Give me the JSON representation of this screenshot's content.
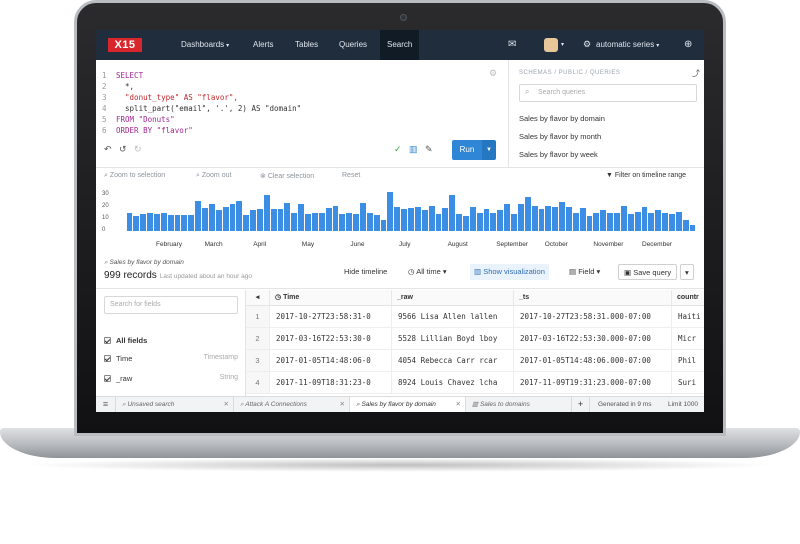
{
  "nav": {
    "logo": "X15",
    "items": [
      {
        "label": "Dashboards",
        "caret": "▾"
      },
      {
        "label": "Alerts"
      },
      {
        "label": "Tables"
      },
      {
        "label": "Queries"
      },
      {
        "label": "Search"
      }
    ],
    "series": "automatic series",
    "caret": "▾"
  },
  "editor": {
    "lines": [
      {
        "n": "1",
        "t": "SELECT",
        "c": "kw"
      },
      {
        "n": "2",
        "t": "  *,",
        "c": "plain"
      },
      {
        "n": "3",
        "t": "  \"donut_type\" AS \"flavor\",",
        "c": "str"
      },
      {
        "n": "4",
        "t": "  split_part(\"email\", '.', 2) AS \"domain\"",
        "c": "plain"
      },
      {
        "n": "5",
        "t": "FROM \"Donuts\"",
        "c": "kw"
      },
      {
        "n": "6",
        "t": "ORDER BY \"flavor\"",
        "c": "kw"
      }
    ],
    "run_label": "Run"
  },
  "side": {
    "heading": "SCHEMAS / PUBLIC / QUERIES",
    "search_placeholder": "Search queries",
    "items": [
      "Sales by flavor by domain",
      "Sales by flavor by month",
      "Sales by flavor by week"
    ]
  },
  "chart_tools": {
    "zoom_selection": "Zoom to selection",
    "zoom_out": "Zoom out",
    "clear_selection": "Clear selection",
    "reset": "Reset",
    "filter": "Filter on timeline range"
  },
  "chart_data": {
    "type": "bar",
    "y_ticks": [
      "30",
      "20",
      "10",
      "0"
    ],
    "ylim": [
      0,
      33
    ],
    "months": [
      "February",
      "March",
      "April",
      "May",
      "June",
      "July",
      "August",
      "September",
      "October",
      "November",
      "December"
    ],
    "values": [
      15,
      12,
      14,
      15,
      14,
      15,
      13,
      13,
      13,
      13,
      25,
      19,
      22,
      17,
      20,
      22,
      25,
      13,
      17,
      18,
      30,
      18,
      18,
      23,
      15,
      22,
      14,
      15,
      15,
      19,
      21,
      14,
      15,
      14,
      23,
      15,
      13,
      9,
      32,
      20,
      18,
      19,
      20,
      17,
      21,
      14,
      19,
      30,
      14,
      12,
      20,
      15,
      18,
      15,
      17,
      22,
      14,
      22,
      28,
      21,
      18,
      21,
      20,
      24,
      20,
      15,
      19,
      12,
      15,
      17,
      15,
      15,
      21,
      14,
      16,
      20,
      15,
      17,
      15,
      14,
      16,
      9,
      5
    ]
  },
  "results": {
    "query_name": "Sales by flavor by domain",
    "count": "999 records",
    "updated": "Last updated about an hour ago",
    "hide_timeline": "Hide timeline",
    "all_time": "All time",
    "show_viz": "Show visualization",
    "field": "Field",
    "save_query": "Save query"
  },
  "fields": {
    "search_placeholder": "Search for fields",
    "rows": [
      {
        "name": "All fields",
        "type": ""
      },
      {
        "name": "Time",
        "type": "Timestamp"
      },
      {
        "name": "_raw",
        "type": "String"
      }
    ]
  },
  "table": {
    "headers": [
      "Time",
      "_raw",
      "_ts",
      "countr"
    ],
    "rows": [
      {
        "n": "1",
        "time": "2017-10-27T23:58:31-0",
        "raw": "9566 Lisa Allen lallen",
        "ts": "2017-10-27T23:58:31.000-07:00",
        "country": "Haiti"
      },
      {
        "n": "2",
        "time": "2017-03-16T22:53:30-0",
        "raw": "5528 Lillian Boyd lboy",
        "ts": "2017-03-16T22:53:30.000-07:00",
        "country": "Micr"
      },
      {
        "n": "3",
        "time": "2017-01-05T14:48:06-0",
        "raw": "4054 Rebecca Carr rcar",
        "ts": "2017-01-05T14:48:06.000-07:00",
        "country": "Phil"
      },
      {
        "n": "4",
        "time": "2017-11-09T18:31:23-0",
        "raw": "8924 Louis Chavez lcha",
        "ts": "2017-11-09T19:31:23.000-07:00",
        "country": "Suri"
      }
    ]
  },
  "tabs": {
    "items": [
      "Unsaved search",
      "Attack A Connections",
      "Sales by flavor by domain",
      "Sales to domains"
    ],
    "generated": "Generated in 9 ms",
    "limit": "Limit 1000"
  }
}
